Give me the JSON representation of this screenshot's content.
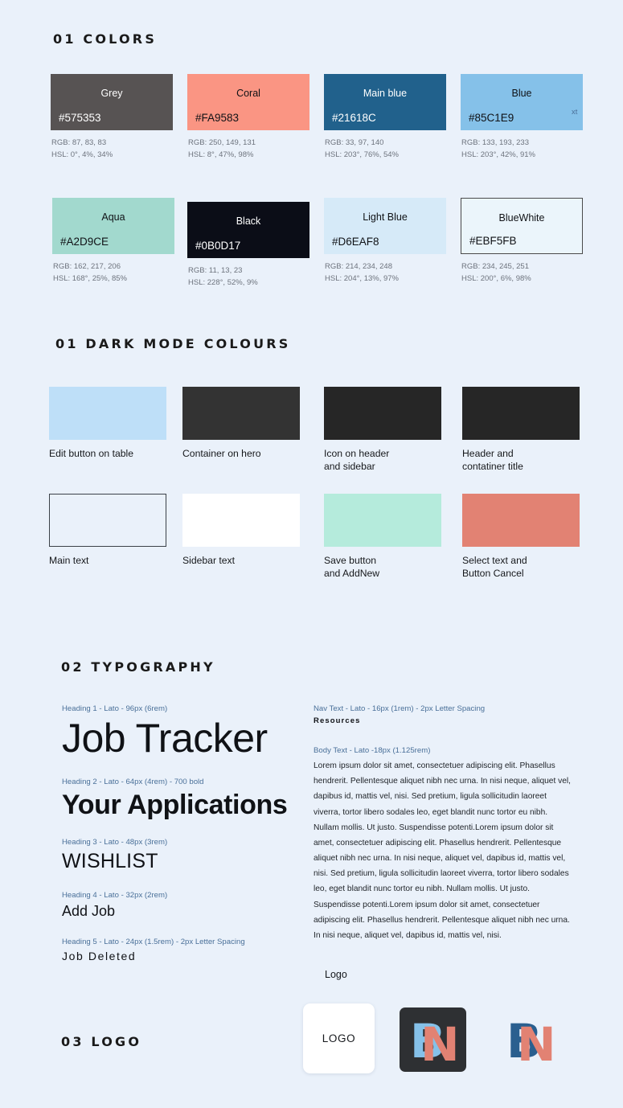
{
  "sections": {
    "colors": {
      "title": "01 COLORS"
    },
    "darkmode": {
      "title": "01 DARK MODE COLOURS"
    },
    "typography": {
      "title": "02 TYPOGRAPHY"
    },
    "logo": {
      "title": "03 LOGO"
    }
  },
  "colors": {
    "row1": [
      {
        "name": "Grey",
        "hex": "#575353",
        "rgb": "RGB: 87, 83, 83",
        "hsl": "HSL: 0°, 4%, 34%",
        "bg": "#575353",
        "text": "#ffffff",
        "bordered": false
      },
      {
        "name": "Coral",
        "hex": "#FA9583",
        "rgb": "RGB: 250, 149, 131",
        "hsl": "HSL: 8°, 47%, 98%",
        "bg": "#FA9583",
        "text": "#101216",
        "bordered": false
      },
      {
        "name": "Main blue",
        "hex": "#21618C",
        "rgb": "RGB: 33, 97, 140",
        "hsl": "HSL: 203°, 76%, 54%",
        "bg": "#21618C",
        "text": "#ffffff",
        "bordered": false
      },
      {
        "name": "Blue",
        "hex": "#85C1E9",
        "rgb": "RGB: 133, 193, 233",
        "hsl": "HSL: 203°, 42%, 91%",
        "bg": "#85C1E9",
        "text": "#101216",
        "bordered": false
      }
    ],
    "row2": [
      {
        "name": "Aqua",
        "hex": "#A2D9CE",
        "rgb": "RGB: 162, 217, 206",
        "hsl": "HSL: 168°, 25%, 85%",
        "bg": "#A2D9CE",
        "text": "#101216",
        "bordered": false
      },
      {
        "name": "Black",
        "hex": "#0B0D17",
        "rgb": "RGB: 11, 13, 23",
        "hsl": "HSL: 228°, 52%, 9%",
        "bg": "#0B0D17",
        "text": "#ffffff",
        "bordered": false
      },
      {
        "name": "Light Blue",
        "hex": "#D6EAF8",
        "rgb": "RGB: 214, 234, 248",
        "hsl": "HSL: 204°, 13%, 97%",
        "bg": "#D6EAF8",
        "text": "#101216",
        "bordered": false
      },
      {
        "name": "BlueWhite",
        "hex": "#EBF5FB",
        "rgb": "RGB: 234, 245, 251",
        "hsl": "HSL: 200°, 6%, 98%",
        "bg": "#EBF5FB",
        "text": "#101216",
        "bordered": true
      }
    ],
    "clipped_fragment": "xt"
  },
  "darkmode": {
    "row1": [
      {
        "label": "Edit button on table",
        "bg": "#BEDFF8",
        "bordered": false
      },
      {
        "label": "Container on hero",
        "bg": "#333333",
        "bordered": false
      },
      {
        "label": "Icon on header\nand sidebar",
        "bg": "#262626",
        "bordered": false
      },
      {
        "label": "Header and\ncontatiner title",
        "bg": "#262626",
        "bordered": false
      }
    ],
    "row2": [
      {
        "label": "Main text",
        "bg": "#eaf1fa",
        "bordered": true
      },
      {
        "label": "Sidebar text",
        "bg": "#FFFFFF",
        "bordered": false
      },
      {
        "label": "Save button\nand AddNew",
        "bg": "#B5EBDC",
        "bordered": false
      },
      {
        "label": "Select text and\nButton Cancel",
        "bg": "#E28273",
        "bordered": false
      }
    ]
  },
  "typography": {
    "left": [
      {
        "label": "Heading 1 - Lato - 96px (6rem)",
        "sample": "Job Tracker"
      },
      {
        "label": "Heading 2 - Lato - 64px (4rem) - 700 bold",
        "sample": "Your Applications"
      },
      {
        "label": "Heading 3 - Lato - 48px (3rem)",
        "sample": "WISHLIST"
      },
      {
        "label": "Heading 4 - Lato - 32px (2rem)",
        "sample": "Add Job"
      },
      {
        "label": "Heading 5 - Lato - 24px (1.5rem) - 2px Letter Spacing",
        "sample": "Job Deleted"
      }
    ],
    "nav": {
      "label": "Nav Text - Lato - 16px (1rem) - 2px Letter Spacing",
      "sample": "Resources"
    },
    "body": {
      "label": "Body Text - Lato -18px (1.125rem)",
      "sample": "Lorem ipsum dolor sit amet, consectetuer adipiscing elit. Phasellus hendrerit. Pellentesque aliquet nibh nec urna. In nisi neque, aliquet vel, dapibus id, mattis vel, nisi. Sed pretium, ligula sollicitudin laoreet viverra, tortor libero sodales leo, eget blandit nunc tortor eu nibh. Nullam mollis. Ut justo. Suspendisse potenti.Lorem ipsum dolor sit amet, consectetuer adipiscing elit. Phasellus hendrerit. Pellentesque aliquet nibh nec urna. In nisi neque, aliquet vel, dapibus id, mattis vel, nisi. Sed pretium, ligula sollicitudin laoreet viverra, tortor libero sodales leo, eget blandit nunc tortor eu nibh. Nullam mollis. Ut justo. Suspendisse potenti.Lorem ipsum dolor sit amet, consectetuer adipiscing elit. Phasellus hendrerit. Pellentesque aliquet nibh nec urna. In nisi neque, aliquet vel, dapibus id, mattis vel, nisi."
    }
  },
  "logo": {
    "caption": "Logo",
    "placeholder_text": "LOGO",
    "monogram_letters": "BN",
    "dark_tile_bg": "#2e3033",
    "b_light": "#85C1E9",
    "b_dark": "#21618C",
    "n_coral": "#E28273"
  }
}
